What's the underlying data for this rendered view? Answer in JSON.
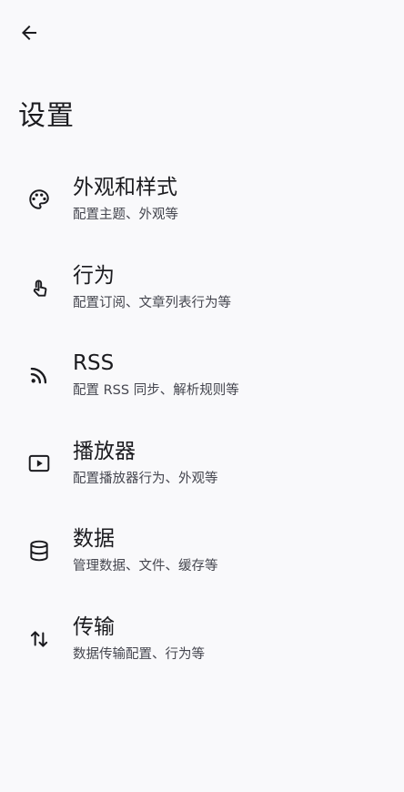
{
  "header": {
    "back_icon": "arrow-back-icon",
    "title": "设置"
  },
  "settings": {
    "items": [
      {
        "id": "appearance",
        "icon": "palette-icon",
        "title": "外观和样式",
        "subtitle": "配置主题、外观等"
      },
      {
        "id": "behavior",
        "icon": "touch-gesture-icon",
        "title": "行为",
        "subtitle": "配置订阅、文章列表行为等"
      },
      {
        "id": "rss",
        "icon": "rss-feed-icon",
        "title": "RSS",
        "subtitle": "配置 RSS 同步、解析规则等"
      },
      {
        "id": "player",
        "icon": "play-box-icon",
        "title": "播放器",
        "subtitle": "配置播放器行为、外观等"
      },
      {
        "id": "data",
        "icon": "database-icon",
        "title": "数据",
        "subtitle": "管理数据、文件、缓存等"
      },
      {
        "id": "transfer",
        "icon": "swap-vertical-icon",
        "title": "传输",
        "subtitle": "数据传输配置、行为等"
      }
    ]
  },
  "colors": {
    "background": "#f9f9fb",
    "text_primary": "#1b1b1f",
    "text_secondary": "#45464f"
  }
}
